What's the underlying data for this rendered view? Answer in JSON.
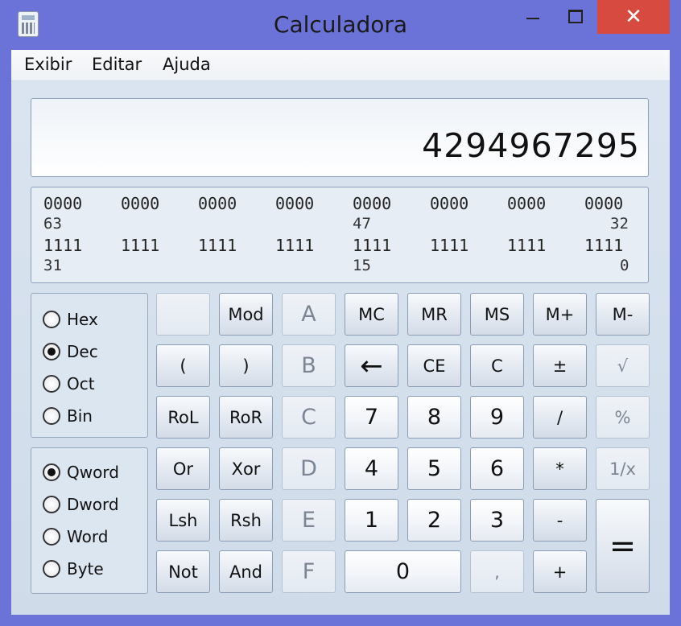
{
  "window": {
    "title": "Calculadora",
    "close_glyph": "✕",
    "app_icon": "calculator-icon"
  },
  "menu": [
    "Exibir",
    "Editar",
    "Ajuda"
  ],
  "display": {
    "value": "4294967295"
  },
  "bit_display": {
    "row1": [
      "0000",
      "0000",
      "0000",
      "0000",
      "0000",
      "0000",
      "0000",
      "0000"
    ],
    "row1_indices": [
      "63",
      "47",
      "32"
    ],
    "row2": [
      "1111",
      "1111",
      "1111",
      "1111",
      "1111",
      "1111",
      "1111",
      "1111"
    ],
    "row2_indices": [
      "31",
      "15",
      "0"
    ]
  },
  "base": {
    "options": [
      "Hex",
      "Dec",
      "Oct",
      "Bin"
    ],
    "selected": "Dec"
  },
  "word_size": {
    "options": [
      "Qword",
      "Dword",
      "Word",
      "Byte"
    ],
    "selected": "Qword"
  },
  "keys": {
    "row1": [
      "",
      "Mod",
      "A",
      "MC",
      "MR",
      "MS",
      "M+",
      "M-"
    ],
    "row2": [
      "(",
      ")",
      "B",
      "←",
      "CE",
      "C",
      "±",
      "√"
    ],
    "row3": [
      "RoL",
      "RoR",
      "C",
      "7",
      "8",
      "9",
      "/",
      "%"
    ],
    "row4": [
      "Or",
      "Xor",
      "D",
      "4",
      "5",
      "6",
      "*",
      "1/x"
    ],
    "row5": [
      "Lsh",
      "Rsh",
      "E",
      "1",
      "2",
      "3",
      "-",
      "="
    ],
    "row6": [
      "Not",
      "And",
      "F",
      "0",
      ",",
      "+"
    ]
  },
  "colors": {
    "title_bar": "#6b73d9",
    "close_button": "#d64a3f",
    "client": "#d6e0ec"
  }
}
